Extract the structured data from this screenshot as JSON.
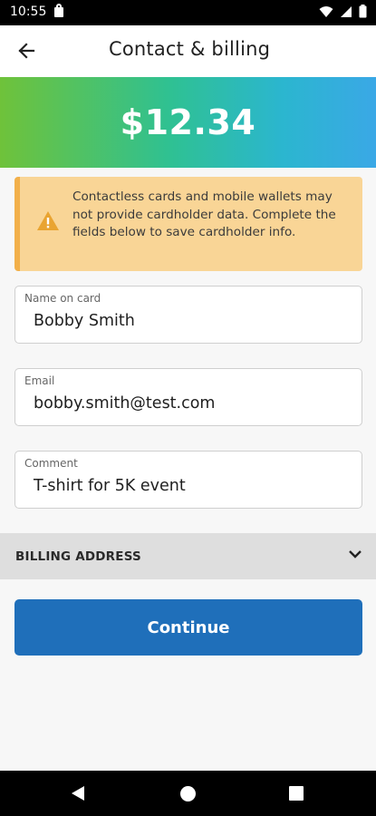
{
  "status_bar": {
    "time": "10:55",
    "icons": [
      "lock-icon",
      "wifi-icon",
      "signal-icon",
      "battery-icon"
    ]
  },
  "header": {
    "title": "Contact & billing",
    "back_icon": "arrow-left-icon"
  },
  "amount": {
    "value": "$12.34",
    "gradient_colors": [
      "#6fc23a",
      "#2fc192",
      "#3aa8e6"
    ]
  },
  "warning": {
    "icon": "warning-triangle-icon",
    "text": "Contactless cards and mobile wallets may not provide cardholder data. Complete the fields below to save cardholder info.",
    "background": "#f9d596",
    "accent": "#f2b04a"
  },
  "form": {
    "name": {
      "label": "Name on card",
      "value": "Bobby Smith"
    },
    "email": {
      "label": "Email",
      "value": "bobby.smith@test.com"
    },
    "comment": {
      "label": "Comment",
      "value": "T-shirt for 5K event"
    }
  },
  "billing": {
    "label": "BILLING ADDRESS",
    "icon": "chevron-down-icon"
  },
  "continue_button": {
    "label": "Continue",
    "color": "#1f6fba"
  },
  "nav_bar": {
    "icons": [
      "nav-back-icon",
      "nav-home-icon",
      "nav-recents-icon"
    ]
  }
}
